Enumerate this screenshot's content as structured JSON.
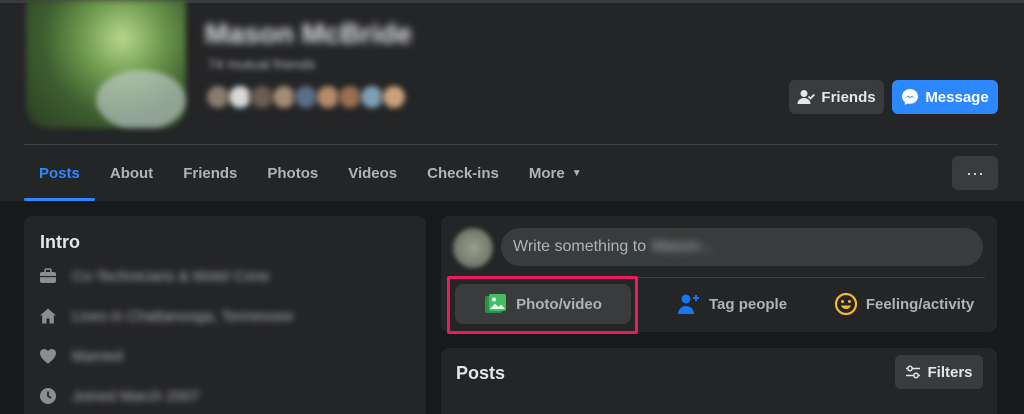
{
  "profile": {
    "name": "Mason McBride",
    "subtitle": "74 mutual friends",
    "avatar_colors": [
      "#8a7d6e",
      "#d9d9d9",
      "#6b5e53",
      "#a48b74",
      "#5b6e88",
      "#b58c6a",
      "#9a6f52",
      "#7f9fb6",
      "#c9a27c"
    ]
  },
  "header_buttons": {
    "friends_label": "Friends",
    "message_label": "Message"
  },
  "tabs": [
    {
      "label": "Posts",
      "active": true
    },
    {
      "label": "About"
    },
    {
      "label": "Friends"
    },
    {
      "label": "Photos"
    },
    {
      "label": "Videos"
    },
    {
      "label": "Check-ins"
    },
    {
      "label": "More"
    }
  ],
  "more_button": "···",
  "intro": {
    "title": "Intro",
    "items": [
      {
        "icon": "briefcase-icon",
        "text": "Co-Technicians & Motel Cone"
      },
      {
        "icon": "home-icon",
        "text": "Lives in Chattanooga, Tennessee"
      },
      {
        "icon": "heart-icon",
        "text": "Married"
      },
      {
        "icon": "clock-icon",
        "text": "Joined March 2007"
      }
    ]
  },
  "composer": {
    "placeholder": "Write something to",
    "blurred_name": "Mason...",
    "actions": {
      "photo": "Photo/video",
      "tag": "Tag people",
      "feeling": "Feeling/activity"
    }
  },
  "posts": {
    "title": "Posts",
    "filters_label": "Filters"
  },
  "colors": {
    "accent": "#2d88ff",
    "highlight": "#ec1b5a",
    "photo_green": "#45bd62",
    "tag_blue": "#1877f2",
    "feeling_yellow": "#f7b928"
  }
}
